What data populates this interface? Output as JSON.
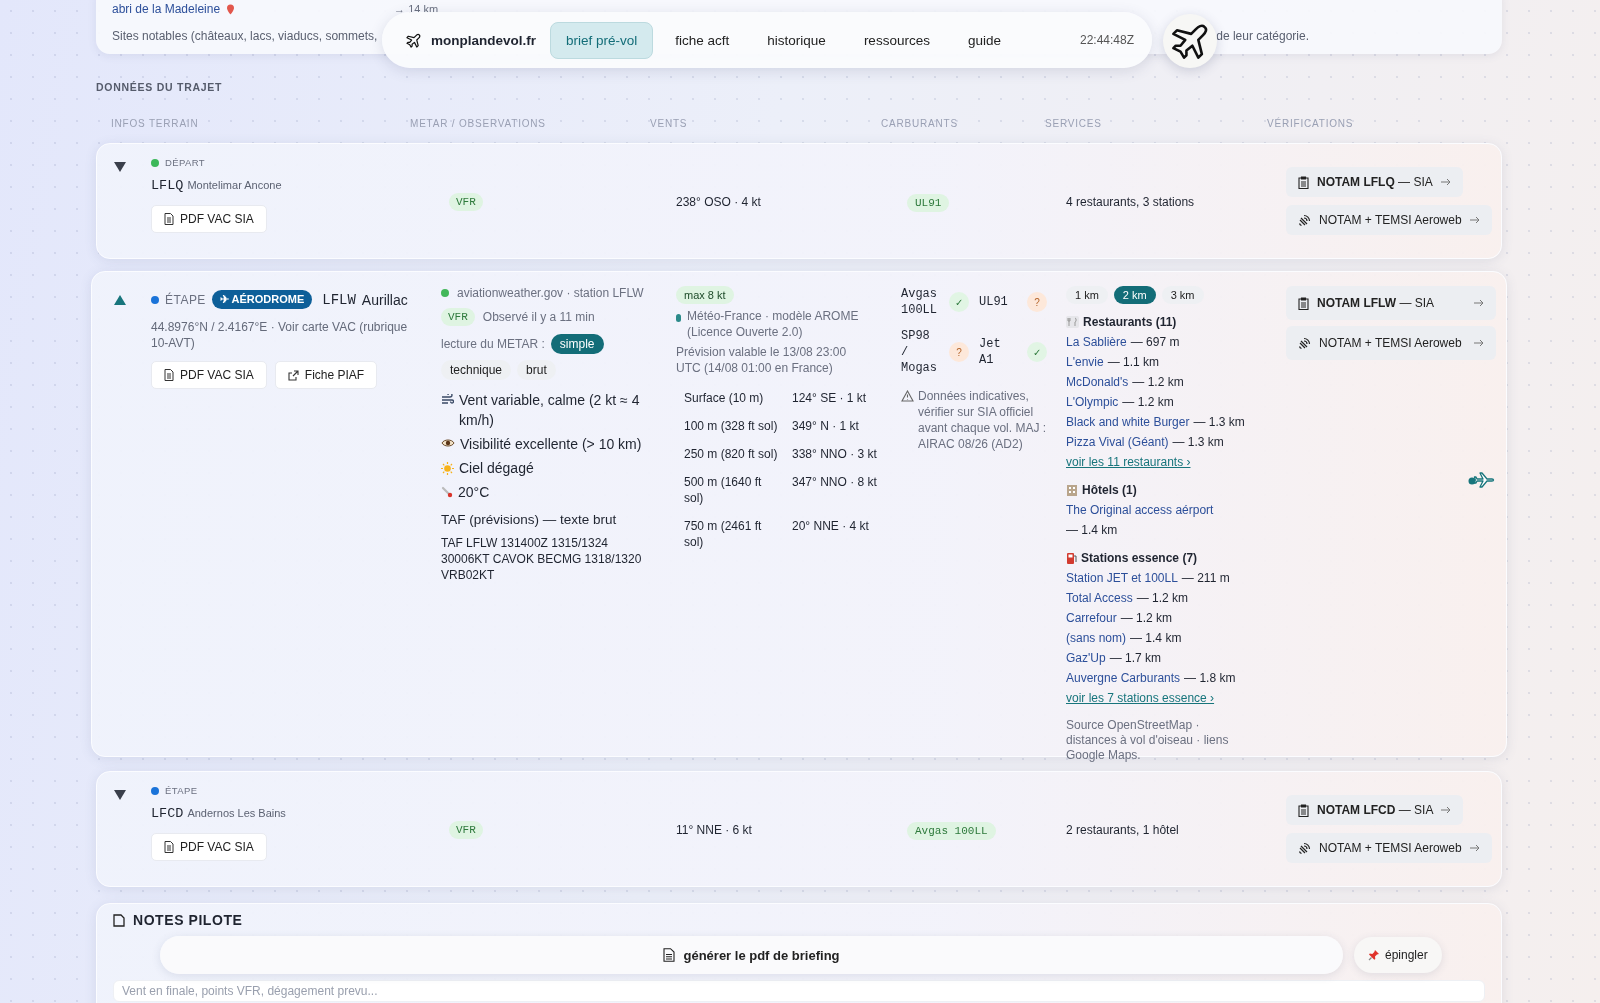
{
  "top_card": {
    "place": "abri de la Madeleine",
    "distance": "→ 14 km",
    "text_left": "Sites notables (châteaux, lacs, viaducs, sommets,",
    "text_right": "de leur catégorie."
  },
  "nav": {
    "brand": "monplandevol.fr",
    "tabs": [
      {
        "label": "brief pré-vol",
        "selected": true
      },
      {
        "label": "fiche acft",
        "selected": false
      },
      {
        "label": "historique",
        "selected": false
      },
      {
        "label": "ressources",
        "selected": false
      },
      {
        "label": "guide",
        "selected": false
      }
    ],
    "clock": "22:44:48Z"
  },
  "section_title": "DONNÉES DU TRAJET",
  "columns": [
    "INFOS TERRAIN",
    "METAR / OBSERVATIONS",
    "VENTS",
    "CARBURANTS",
    "SERVICES",
    "VÉRIFICATIONS"
  ],
  "legs": [
    {
      "expanded": false,
      "role": "DÉPART",
      "color": "#3cb85a",
      "code": "LFLQ",
      "name": "Montelimar Ancone",
      "buttons": [
        {
          "kind": "pdf",
          "label": "PDF VAC SIA"
        }
      ],
      "flight_rules": "VFR",
      "wind": "238° OSO · 4 kt",
      "fuels": [
        "UL91"
      ],
      "services": "4 restaurants, 3 stations",
      "checks": [
        {
          "kind": "sia",
          "label": "**NOTAM LFLQ** — SIA"
        },
        {
          "kind": "aeroweb",
          "label": "NOTAM + TEMSI Aeroweb"
        }
      ]
    },
    {
      "expanded": true,
      "role": "ÉTAPE",
      "color": "#1a73d9",
      "badge": "✈ AÉRODROME",
      "code": "LFLW",
      "name": "Aurillac",
      "coords": "44.8976°N / 2.4167°E · Voir carte VAC (rubrique 10-AVT)",
      "buttons": [
        {
          "kind": "pdf",
          "label": "PDF VAC SIA"
        },
        {
          "kind": "external",
          "label": "Fiche PIAF"
        }
      ],
      "metar": {
        "source": "aviationweather.gov · station LFLW",
        "flight_rules": "VFR",
        "observed": "Observé il y a 11 min",
        "mode_label": "lecture du METAR :",
        "modes": [
          {
            "label": "simple",
            "selected": true
          },
          {
            "label": "technique",
            "selected": false
          },
          {
            "label": "brut",
            "selected": false
          }
        ],
        "lines": [
          {
            "kind": "wind",
            "text": "Vent variable, calme (2 kt ≈ 4 km/h)"
          },
          {
            "kind": "visibility",
            "text": "Visibilité excellente (> 10 km)"
          },
          {
            "kind": "sky",
            "text": "Ciel dégagé"
          },
          {
            "kind": "temperature",
            "text": "20°C"
          }
        ],
        "taf_title": "TAF (prévisions) — texte brut",
        "taf": "TAF LFLW 131400Z 1315/1324 30006KT CAVOK BECMG 1318/1320 VRB02KT"
      },
      "winds": {
        "max": "max 8 kt",
        "source": "Météo-France · modèle AROME (Licence Ouverte 2.0)",
        "validity": "Prévision valable le 13/08 23:00 UTC (14/08 01:00 en France)",
        "levels": [
          {
            "altitude": "Surface (10 m)",
            "wind": "124° SE · 1 kt"
          },
          {
            "altitude": "100 m (328 ft sol)",
            "wind": "349° N · 1 kt"
          },
          {
            "altitude": "250 m (820 ft sol)",
            "wind": "338° NNO · 3 kt"
          },
          {
            "altitude": "500 m (1640 ft sol)",
            "wind": "347° NNO · 8 kt"
          },
          {
            "altitude": "750 m (2461 ft sol)",
            "wind": "20° NNE · 4 kt"
          }
        ]
      },
      "fuel_table": [
        {
          "name": "Avgas 100LL",
          "mark": "✓",
          "confirmed": true
        },
        {
          "name": "UL91",
          "mark": "?",
          "confirmed": false
        },
        {
          "name": "SP98 / Mogas",
          "mark": "?",
          "confirmed": false
        },
        {
          "name": "Jet A1",
          "mark": "✓",
          "confirmed": true
        }
      ],
      "fuel_note": "Données indicatives, vérifier sur SIA officiel avant chaque vol. MAJ : AIRAC 08/26 (AD2)",
      "services": {
        "radii": [
          {
            "label": "1 km",
            "selected": false
          },
          {
            "label": "2 km",
            "selected": true
          },
          {
            "label": "3 km",
            "selected": false
          }
        ],
        "groups": [
          {
            "kind": "restaurant",
            "title": "Restaurants (11)",
            "items": [
              {
                "name": "La Sablière",
                "distance": "— 697 m"
              },
              {
                "name": "L'envie",
                "distance": "— 1.1 km"
              },
              {
                "name": "McDonald's",
                "distance": "— 1.2 km"
              },
              {
                "name": "L'Olympic",
                "distance": "— 1.2 km"
              },
              {
                "name": "Black and white Burger",
                "distance": "— 1.3 km"
              },
              {
                "name": "Pizza Vival (Géant)",
                "distance": "— 1.3 km"
              }
            ],
            "more": "voir les 11 restaurants ›"
          },
          {
            "kind": "hotel",
            "title": "Hôtels (1)",
            "items": [
              {
                "name": "The Original access aérport",
                "distance": "— 1.4 km"
              }
            ]
          },
          {
            "kind": "fuel",
            "title": "Stations essence (7)",
            "items": [
              {
                "name": "Station JET et 100LL",
                "distance": "— 211 m"
              },
              {
                "name": "Total Access",
                "distance": "— 1.2 km"
              },
              {
                "name": "Carrefour",
                "distance": "— 1.2 km"
              },
              {
                "name": "(sans nom)",
                "distance": "— 1.4 km"
              },
              {
                "name": "Gaz'Up",
                "distance": "— 1.7 km"
              },
              {
                "name": "Auvergne Carburants",
                "distance": "— 1.8 km"
              }
            ],
            "more": "voir les 7 stations essence ›"
          }
        ],
        "source": "Source OpenStreetMap · distances à vol d'oiseau · liens Google Maps."
      },
      "checks": [
        {
          "kind": "sia",
          "label": "**NOTAM LFLW** — SIA"
        },
        {
          "kind": "aeroweb",
          "label": "NOTAM + TEMSI Aeroweb"
        }
      ]
    },
    {
      "expanded": false,
      "role": "ÉTAPE",
      "color": "#1a73d9",
      "code": "LFCD",
      "name": "Andernos Les Bains",
      "buttons": [
        {
          "kind": "pdf",
          "label": "PDF VAC SIA"
        }
      ],
      "flight_rules": "VFR",
      "wind": "11° NNE · 6 kt",
      "fuels": [
        "Avgas 100LL"
      ],
      "services": "2 restaurants, 1 hôtel",
      "checks": [
        {
          "kind": "sia",
          "label": "**NOTAM LFCD** — SIA"
        },
        {
          "kind": "aeroweb",
          "label": "NOTAM + TEMSI Aeroweb"
        }
      ]
    }
  ],
  "notes": {
    "title": "NOTES PILOTE",
    "placeholder": "Vent en finale, points VFR, dégagement prevu..."
  },
  "action_bar": {
    "generate": "générer le pdf de briefing",
    "pin": "épingler"
  }
}
